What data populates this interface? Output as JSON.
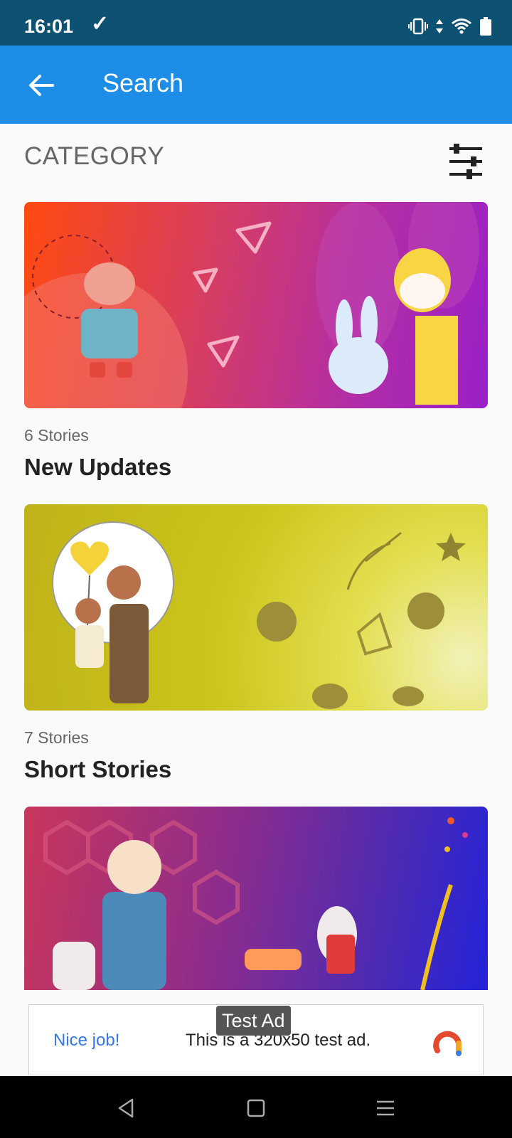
{
  "status_bar": {
    "time": "16:01"
  },
  "app_bar": {
    "title": "Search"
  },
  "section": {
    "title": "CATEGORY"
  },
  "categories": [
    {
      "count": "6 Stories",
      "title": "New Updates"
    },
    {
      "count": "7 Stories",
      "title": "Short Stories"
    },
    {
      "count": "",
      "title": ""
    }
  ],
  "ad": {
    "tag": "Test Ad",
    "headline": "Nice job!",
    "body": "This is a 320x50 test ad."
  },
  "colors": {
    "status_bar": "#0d5173",
    "app_bar": "#1e8de7",
    "ad_link": "#3577e6"
  }
}
